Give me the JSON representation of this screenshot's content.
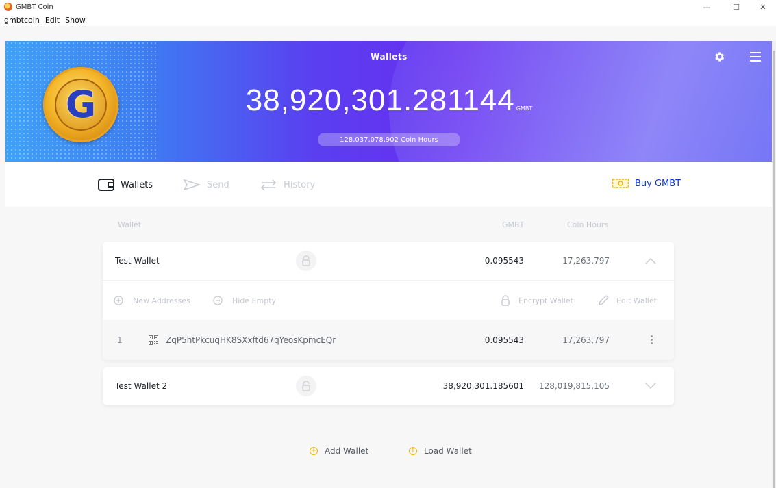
{
  "window": {
    "title": "GMBT Coin",
    "minimize": "—",
    "maximize": "☐",
    "close": "✕"
  },
  "menu": [
    "gmbtcoin",
    "Edit",
    "Show"
  ],
  "header": {
    "title": "Wallets",
    "balance": "38,920,301.281144",
    "unit": "GMBT",
    "coin_hours": "128,037,078,902 Coin Hours"
  },
  "nav": {
    "wallets": "Wallets",
    "send": "Send",
    "history": "History",
    "buy": "Buy GMBT"
  },
  "table": {
    "col_wallet": "Wallet",
    "col_gmbt": "GMBT",
    "col_hours": "Coin Hours"
  },
  "wallets": [
    {
      "name": "Test Wallet",
      "gmbt": "0.095543",
      "hours": "17,263,797"
    },
    {
      "name": "Test Wallet 2",
      "gmbt": "38,920,301.185601",
      "hours": "128,019,815,105"
    }
  ],
  "wallet_actions": {
    "new_addresses": "New Addresses",
    "hide_empty": "Hide Empty",
    "encrypt": "Encrypt Wallet",
    "edit": "Edit Wallet"
  },
  "address": {
    "index": "1",
    "value": "ZqP5htPkcuqHK8SXxftd67qYeosKpmcEQr",
    "gmbt": "0.095543",
    "hours": "17,263,797"
  },
  "footer": {
    "add": "Add Wallet",
    "load": "Load Wallet"
  },
  "colors": {
    "accent": "#0b33d6",
    "gold": "#f0b500",
    "header_purple": "#6a2cf0"
  }
}
